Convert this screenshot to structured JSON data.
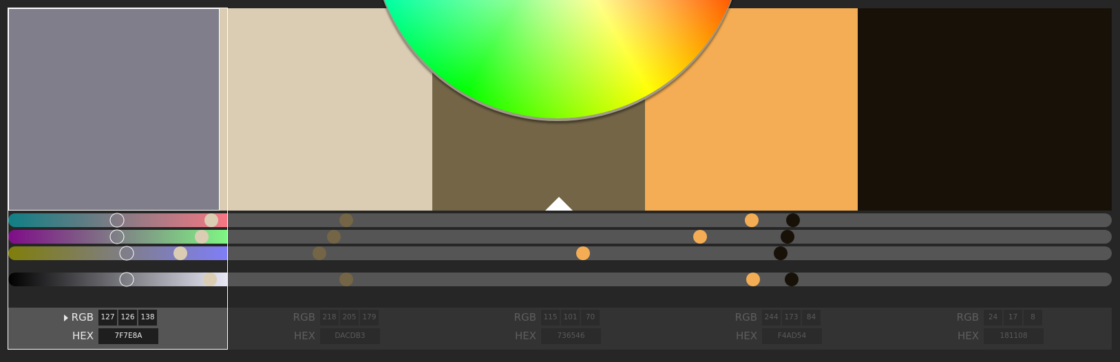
{
  "theme": {
    "accent": "#ffffff",
    "swatches": [
      "#7F7E8A",
      "#DACDB3",
      "#736546",
      "#F4AD54",
      "#181108"
    ]
  },
  "colors": [
    {
      "rgb": {
        "label": "RGB",
        "r": "127",
        "g": "126",
        "b": "138"
      },
      "hex": {
        "label": "HEX",
        "value": "7F7E8A"
      },
      "hex_color": "#7F7E8A",
      "active": true
    },
    {
      "rgb": {
        "label": "RGB",
        "r": "218",
        "g": "205",
        "b": "179"
      },
      "hex": {
        "label": "HEX",
        "value": "DACDB3"
      },
      "hex_color": "#DACDB3",
      "active": false
    },
    {
      "rgb": {
        "label": "RGB",
        "r": "115",
        "g": "101",
        "b": "70"
      },
      "hex": {
        "label": "HEX",
        "value": "736546"
      },
      "hex_color": "#736546",
      "active": false
    },
    {
      "rgb": {
        "label": "RGB",
        "r": "244",
        "g": "173",
        "b": "84"
      },
      "hex": {
        "label": "HEX",
        "value": "F4AD54"
      },
      "hex_color": "#F4AD54",
      "active": false
    },
    {
      "rgb": {
        "label": "RGB",
        "r": "24",
        "g": "17",
        "b": "8"
      },
      "hex": {
        "label": "HEX",
        "value": "181108"
      },
      "hex_color": "#181108",
      "active": false
    }
  ],
  "sliders": [
    {
      "name": "red-green-cyan",
      "gradient": [
        "#0f7f85",
        "#f77783"
      ],
      "levels": [
        0.496,
        0.0,
        0.0,
        0.0,
        0.0
      ]
    },
    {
      "name": "magenta-green",
      "gradient": [
        "#7f0c88",
        "#7ff683"
      ],
      "levels": [
        0.496,
        0.0,
        0.0,
        0.0,
        0.0
      ]
    },
    {
      "name": "yellow-blue",
      "gradient": [
        "#7f7e0a",
        "#7f7ef8"
      ],
      "levels": [
        0.54,
        0.0,
        0.0,
        0.0,
        0.0
      ]
    },
    {
      "name": "luminance",
      "gradient": [
        "#000000",
        "#e8e8f6"
      ],
      "levels": [
        0.54,
        0.0,
        0.0,
        0.0,
        0.0
      ]
    }
  ],
  "knob_levels": [
    [
      0.496,
      0.184,
      0.306,
      0.674,
      0.711
    ],
    [
      0.496,
      0.175,
      0.295,
      0.627,
      0.706
    ],
    [
      0.54,
      0.156,
      0.282,
      0.521,
      0.7
    ],
    [
      0.54,
      0.183,
      0.306,
      0.675,
      0.71
    ]
  ]
}
